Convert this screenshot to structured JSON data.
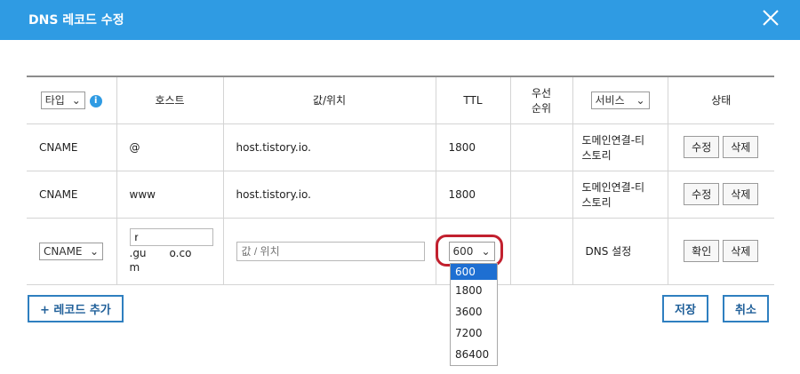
{
  "dialog": {
    "title": "DNS 레코드 수정"
  },
  "header": {
    "type_select": "타입",
    "host": "호스트",
    "value": "값/위치",
    "ttl": "TTL",
    "priority_line1": "우선",
    "priority_line2": "순위",
    "service_select": "서비스",
    "status": "상태"
  },
  "rows": [
    {
      "type": "CNAME",
      "host": "@",
      "value": "host.tistory.io.",
      "ttl": "1800",
      "service_line1": "도메인연결-티",
      "service_line2": "스토리",
      "edit": "수정",
      "delete": "삭제"
    },
    {
      "type": "CNAME",
      "host": "www",
      "value": "host.tistory.io.",
      "ttl": "1800",
      "service_line1": "도메인연결-티",
      "service_line2": "스토리",
      "edit": "수정",
      "delete": "삭제"
    }
  ],
  "new_row": {
    "type": "CNAME",
    "host_value": "r",
    "host_suffix_line1": ".gu",
    "host_suffix_line1b": "o.co",
    "host_suffix_line2": "m",
    "value_placeholder": "값 / 위치",
    "ttl": "600",
    "service": "DNS 설정",
    "confirm": "확인",
    "delete": "삭제"
  },
  "ttl_options": [
    "600",
    "1800",
    "3600",
    "7200",
    "86400"
  ],
  "footer": {
    "add_record": "+ 레코드 추가",
    "save": "저장",
    "cancel": "취소"
  },
  "colors": {
    "titlebar": "#2f9be3",
    "highlight": "#c2202e",
    "selected_option": "#1e6fd2"
  }
}
